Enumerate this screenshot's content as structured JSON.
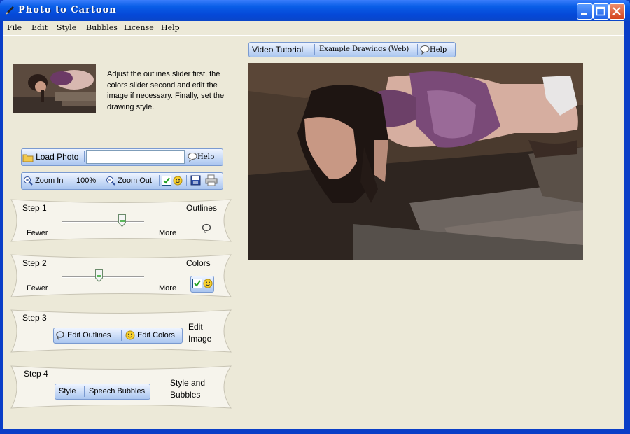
{
  "window": {
    "title": "Photo to Cartoon"
  },
  "menu": [
    "File",
    "Edit",
    "Style",
    "Bubbles",
    "License",
    "Help"
  ],
  "top_toolbar": {
    "video_tutorial": "Video Tutorial",
    "example_drawings": "Example Drawings (Web)",
    "help": "Help"
  },
  "intro_text": "Adjust the outlines slider first, the colors slider second and edit the image if necessary. Finally, set the drawing style.",
  "load_bar": {
    "load_photo": "Load Photo",
    "file_value": "",
    "help": "Help"
  },
  "zoom_bar": {
    "zoom_in": "Zoom In",
    "zoom_level": "100%",
    "zoom_out": "Zoom Out"
  },
  "steps": {
    "step1": {
      "label": "Step 1",
      "title": "Outlines",
      "min_label": "Fewer",
      "max_label": "More",
      "slider_value": 0.73
    },
    "step2": {
      "label": "Step 2",
      "title": "Colors",
      "min_label": "Fewer",
      "max_label": "More",
      "slider_value": 0.45,
      "checkbox_checked": true
    },
    "step3": {
      "label": "Step 3",
      "title_line1": "Edit",
      "title_line2": "Image",
      "edit_outlines": "Edit Outlines",
      "edit_colors": "Edit Colors"
    },
    "step4": {
      "label": "Step 4",
      "title_line1": "Style and",
      "title_line2": "Bubbles",
      "style": "Style",
      "speech_bubbles": "Speech Bubbles"
    }
  },
  "colors": {
    "titlebar": "#0a5fe8",
    "window_bg": "#ece9d8",
    "button_face": "#c9dbf7",
    "step_panel": "#f6f4ec"
  }
}
